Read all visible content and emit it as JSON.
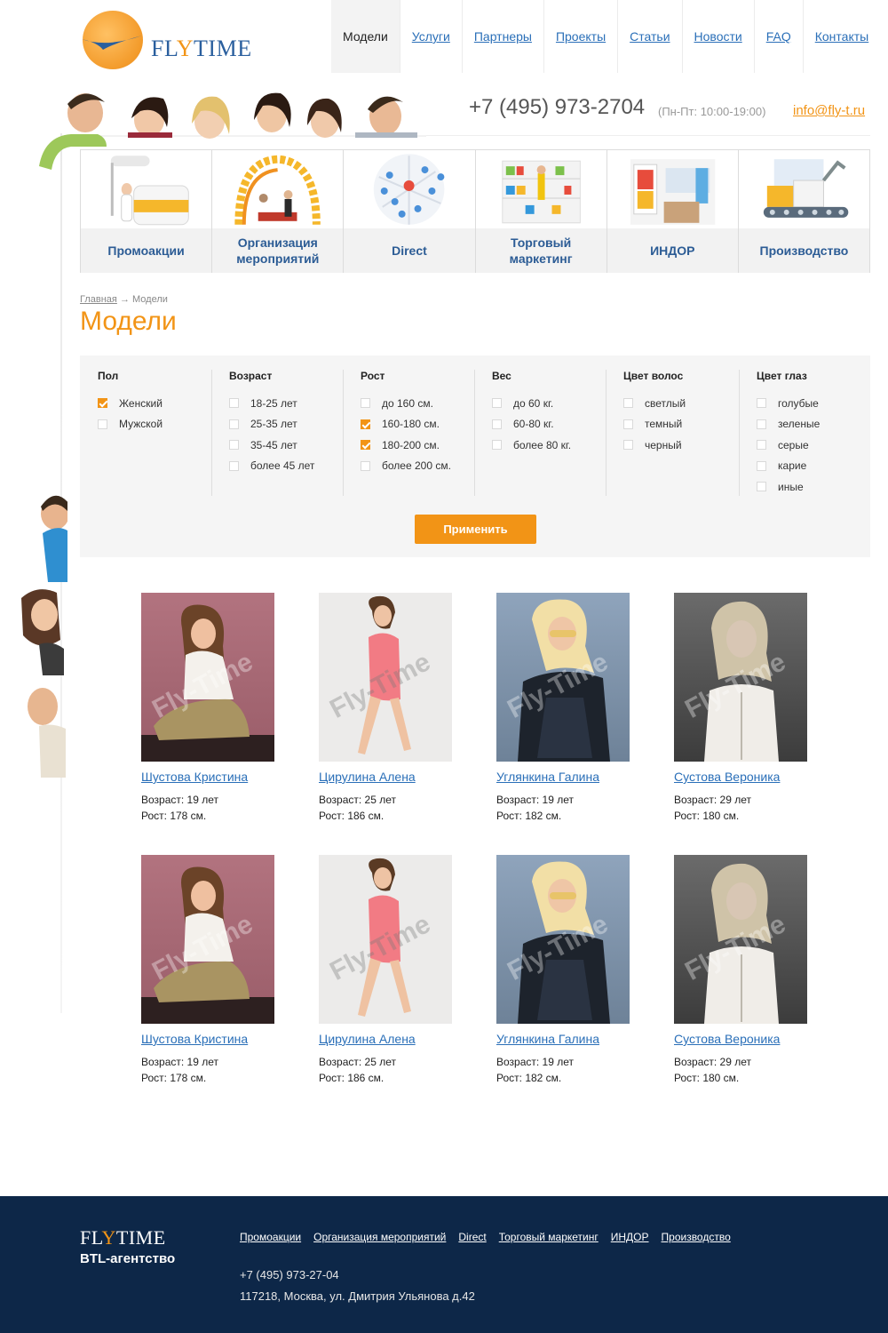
{
  "brand": {
    "name_pre": "FL",
    "name_y": "Y",
    "name_post": "TIME"
  },
  "nav": [
    {
      "label": "Модели",
      "active": true
    },
    {
      "label": "Услуги"
    },
    {
      "label": "Партнеры"
    },
    {
      "label": "Проекты"
    },
    {
      "label": "Статьи"
    },
    {
      "label": "Новости"
    },
    {
      "label": "FAQ"
    },
    {
      "label": "Контакты"
    }
  ],
  "contact": {
    "phone": "+7 (495) 973-2704",
    "hours": "(Пн-Пт: 10:00-19:00)",
    "email": "info@fly-t.ru"
  },
  "services": [
    {
      "label": "Промоакции"
    },
    {
      "label": "Организация мероприятий"
    },
    {
      "label": "Direct"
    },
    {
      "label": "Торговый маркетинг"
    },
    {
      "label": "ИНДОР"
    },
    {
      "label": "Производство"
    }
  ],
  "breadcrumb": {
    "home": "Главная",
    "sep": "→",
    "current": "Модели"
  },
  "page_title": "Модели",
  "filters": {
    "apply_label": "Применить",
    "groups": [
      {
        "title": "Пол",
        "options": [
          {
            "label": "Женский",
            "checked": true
          },
          {
            "label": "Мужской",
            "checked": false
          }
        ]
      },
      {
        "title": "Возраст",
        "options": [
          {
            "label": "18-25 лет",
            "checked": false
          },
          {
            "label": "25-35 лет",
            "checked": false
          },
          {
            "label": "35-45 лет",
            "checked": false
          },
          {
            "label": "более 45 лет",
            "checked": false
          }
        ]
      },
      {
        "title": "Рост",
        "options": [
          {
            "label": "до 160 см.",
            "checked": false
          },
          {
            "label": "160-180 см.",
            "checked": true
          },
          {
            "label": "180-200 см.",
            "checked": true
          },
          {
            "label": "более 200 см.",
            "checked": false
          }
        ]
      },
      {
        "title": "Вес",
        "options": [
          {
            "label": "до 60 кг.",
            "checked": false
          },
          {
            "label": "60-80 кг.",
            "checked": false
          },
          {
            "label": "более 80 кг.",
            "checked": false
          }
        ]
      },
      {
        "title": "Цвет волос",
        "options": [
          {
            "label": "светлый",
            "checked": false
          },
          {
            "label": "темный",
            "checked": false
          },
          {
            "label": "черный",
            "checked": false
          }
        ]
      },
      {
        "title": "Цвет глаз",
        "options": [
          {
            "label": "голубые",
            "checked": false
          },
          {
            "label": "зеленые",
            "checked": false
          },
          {
            "label": "серые",
            "checked": false
          },
          {
            "label": "карие",
            "checked": false
          },
          {
            "label": "иные",
            "checked": false
          }
        ]
      }
    ]
  },
  "watermark": "Fly-Time",
  "models": [
    {
      "name": "Шустова Кристина",
      "age": "Возраст: 19 лет",
      "height": "Рост: 178 см."
    },
    {
      "name": "Цирулина Алена",
      "age": "Возраст: 25 лет",
      "height": "Рост: 186 см."
    },
    {
      "name": "Углянкина Галина",
      "age": "Возраст: 19 лет",
      "height": "Рост: 182 см."
    },
    {
      "name": "Сустова Вероника",
      "age": "Возраст: 29 лет",
      "height": "Рост: 180 см."
    },
    {
      "name": "Шустова Кристина",
      "age": "Возраст: 19 лет",
      "height": "Рост: 178 см."
    },
    {
      "name": "Цирулина Алена",
      "age": "Возраст: 25 лет",
      "height": "Рост: 186 см."
    },
    {
      "name": "Углянкина Галина",
      "age": "Возраст: 19 лет",
      "height": "Рост: 182 см."
    },
    {
      "name": "Сустова Вероника",
      "age": "Возраст: 29 лет",
      "height": "Рост: 180 см."
    }
  ],
  "footer": {
    "tagline": "BTL-агентство",
    "links": [
      "Промоакции",
      "Организация мероприятий",
      "Direct",
      "Торговый маркетинг",
      "ИНДОР",
      "Производство"
    ],
    "phone": "+7 (495) 973-27-04",
    "address": "117218, Москва, ул. Дмитрия Ульянова д.42"
  },
  "colors": {
    "accent": "#f29416",
    "link": "#2a6fb8",
    "service_text": "#2c5c95",
    "footer_bg": "#0d2748"
  }
}
